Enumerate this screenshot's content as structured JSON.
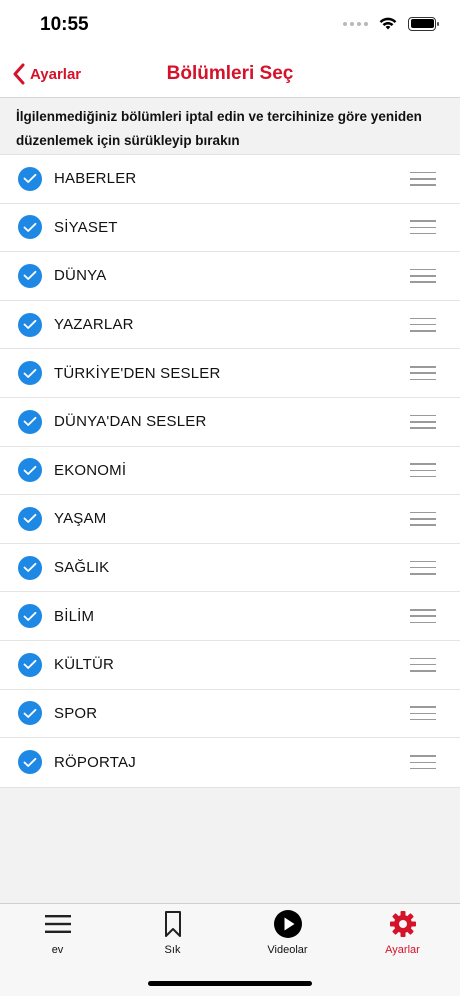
{
  "status_bar": {
    "time": "10:55"
  },
  "nav": {
    "back_label": "Ayarlar",
    "title": "Bölümleri Seç"
  },
  "instructions": "İlgilenmediğiniz bölümleri iptal edin ve tercihinize göre yeniden düzenlemek için sürükleyip bırakın",
  "sections": [
    {
      "label": "HABERLER",
      "checked": true
    },
    {
      "label": "SİYASET",
      "checked": true
    },
    {
      "label": "DÜNYA",
      "checked": true
    },
    {
      "label": "YAZARLAR",
      "checked": true
    },
    {
      "label": "TÜRKİYE'DEN SESLER",
      "checked": true
    },
    {
      "label": "DÜNYA'DAN SESLER",
      "checked": true
    },
    {
      "label": "EKONOMİ",
      "checked": true
    },
    {
      "label": "YAŞAM",
      "checked": true
    },
    {
      "label": "SAĞLIK",
      "checked": true
    },
    {
      "label": "BİLİM",
      "checked": true
    },
    {
      "label": "KÜLTÜR",
      "checked": true
    },
    {
      "label": "SPOR",
      "checked": true
    },
    {
      "label": "RÖPORTAJ",
      "checked": true
    }
  ],
  "tabs": [
    {
      "label": "ev",
      "icon": "menu-icon",
      "active": false
    },
    {
      "label": "Sık",
      "icon": "bookmark-icon",
      "active": false
    },
    {
      "label": "Videolar",
      "icon": "play-icon",
      "active": false
    },
    {
      "label": "Ayarlar",
      "icon": "gear-icon",
      "active": true
    }
  ],
  "colors": {
    "accent": "#d4122a",
    "check": "#1e88e5"
  }
}
